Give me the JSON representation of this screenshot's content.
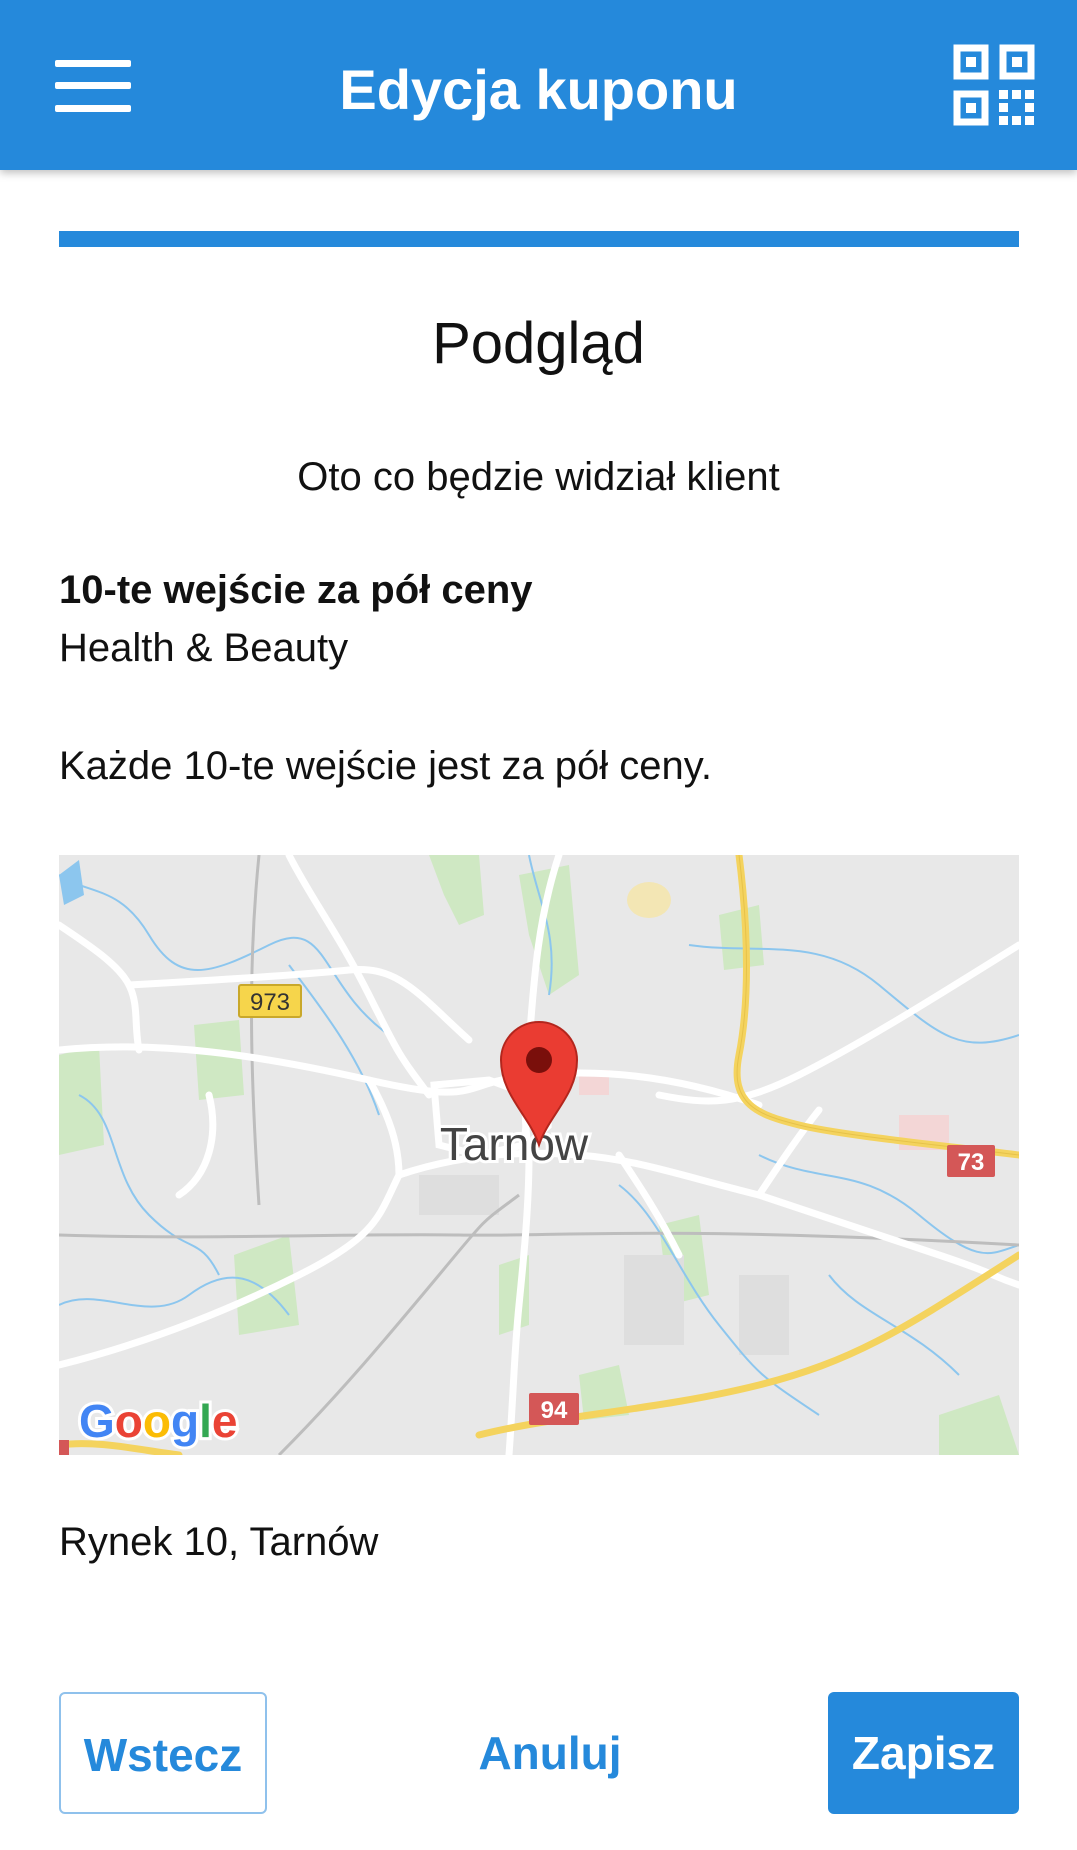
{
  "app_bar": {
    "title": "Edycja kuponu",
    "menu_icon": "hamburger-menu-icon",
    "qr_icon": "qr-code-icon",
    "color": "#2589db"
  },
  "main": {
    "heading": "Podgląd",
    "subheading": "Oto co będzie widział klient",
    "coupon": {
      "title": "10-te wejście za pół ceny",
      "category": "Health & Beauty",
      "description": "Każde 10-te wejście jest za pół ceny."
    },
    "map": {
      "city_label": "Tarnów",
      "road_labels": [
        "973",
        "73",
        "94"
      ],
      "attribution": "Google"
    },
    "address": "Rynek 10, Tarnów"
  },
  "actions": {
    "back_label": "Wstecz",
    "cancel_label": "Anuluj",
    "save_label": "Zapisz"
  }
}
